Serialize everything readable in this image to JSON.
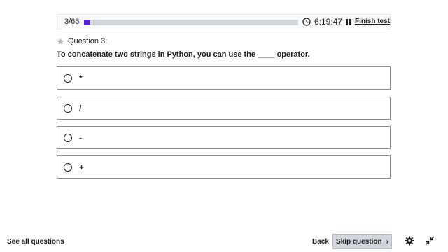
{
  "header": {
    "progress_text": "3/66",
    "progress_fraction": 0.03,
    "timer": "6:19:47",
    "finish_label": "Finish test",
    "icons": {
      "clock": "clock-icon",
      "pause": "pause-icon"
    }
  },
  "question": {
    "label": "Question 3:",
    "text": "To concatenate two strings in Python, you can use the ____ operator.",
    "star_icon": "star-icon"
  },
  "answers": [
    {
      "label": "*"
    },
    {
      "label": "/"
    },
    {
      "label": "-"
    },
    {
      "label": "+"
    }
  ],
  "footer": {
    "see_all": "See all questions",
    "back": "Back",
    "skip": "Skip question",
    "icons": {
      "settings": "gear-icon",
      "exit_fullscreen": "collapse-icon"
    }
  },
  "colors": {
    "accent": "#5624d0",
    "text": "#1c1d1f",
    "border": "#8b8d91"
  }
}
